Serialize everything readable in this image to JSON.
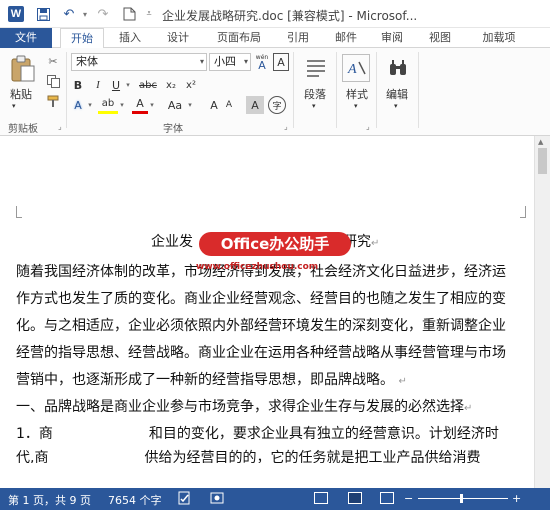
{
  "titlebar": {
    "app_logo": "W",
    "title": "企业发展战略研究.doc [兼容模式] - Microsof..."
  },
  "tabs": [
    {
      "label": "文件"
    },
    {
      "label": "开始"
    },
    {
      "label": "插入"
    },
    {
      "label": "设计"
    },
    {
      "label": "页面布局"
    },
    {
      "label": "引用"
    },
    {
      "label": "邮件"
    },
    {
      "label": "审阅"
    },
    {
      "label": "视图"
    },
    {
      "label": "加载项"
    }
  ],
  "ribbon": {
    "clipboard": {
      "paste_label": "粘贴",
      "group_label": "剪贴板"
    },
    "font": {
      "font_name": "宋体",
      "font_size": "小四",
      "wen_glyph": "wén",
      "A_glyph": "A",
      "grow_glyph": "A",
      "shrink_glyph": "A",
      "case_label": "Aa",
      "bold": "B",
      "italic": "I",
      "underline": "U",
      "strike": "abc",
      "sub": "x₂",
      "sup": "x²",
      "effects": "A",
      "highlight": "ab",
      "font_color": "A",
      "char_shade": "A",
      "circle": "字",
      "group_label": "字体"
    },
    "paragraph": {
      "label": "段落"
    },
    "styles": {
      "label": "样式"
    },
    "editing": {
      "label": "编辑"
    },
    "accent": "#2b579a"
  },
  "document": {
    "heading_left": "企业发",
    "heading_right": "研究",
    "watermark": "Office办公助手",
    "watermark_url": "www.officezhushou.com",
    "lines": [
      "随着我国经济体制的改革，市场经济得到发展，社会经济文化日益进步，经济运",
      "作方式也发生了质的变化。商业企业经营观念、经营目的也随之发生了相应的变",
      "化。与之相适应，企业必须依照内外部经营环境发生的深刻变化，重新调整企业",
      "经营的指导思想、经营战略。商业企业在运用各种经营战略从事经营管理与市场",
      "营销中，也逐渐形成了一种新的经营指导思想，即品牌战略。",
      "一、品牌战略是商业企业参与市场竞争，求得企业生存与发展的必然选择"
    ],
    "line7_left": "1．商",
    "line7_right": "和目的变化，要求企业具有独立的经营意识。计划经济时",
    "line8_left": "代,商",
    "line8_right": "供给为经营目的的，它的任务就是把工业产品供给消费"
  },
  "statusbar": {
    "page": "第 1 页，共 9 页",
    "words": "7654 个字",
    "zoom": "100%"
  }
}
